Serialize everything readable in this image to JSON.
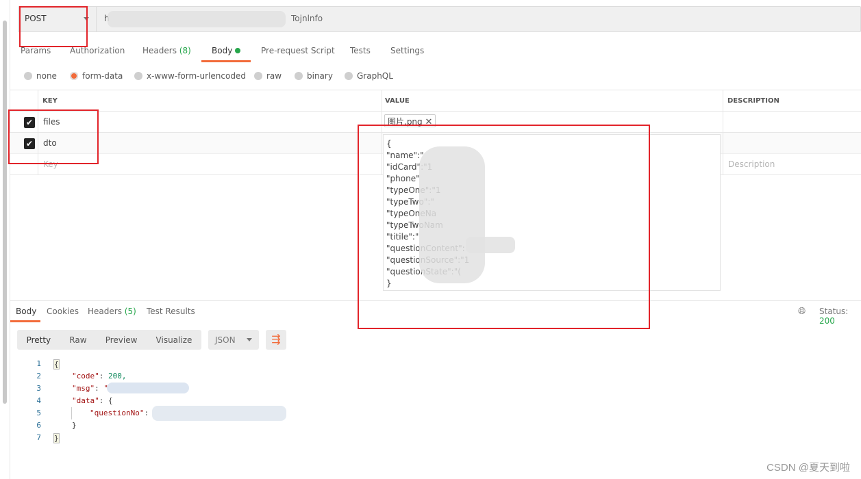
{
  "request": {
    "method": "POST",
    "url_visible_prefix": "h",
    "url_visible_suffix": "Tojnlnfo"
  },
  "tabs": [
    {
      "label": "Params"
    },
    {
      "label": "Authorization"
    },
    {
      "label": "Headers",
      "count": "(8)"
    },
    {
      "label": "Body"
    },
    {
      "label": "Pre-request Script"
    },
    {
      "label": "Tests"
    },
    {
      "label": "Settings"
    }
  ],
  "body_types": [
    {
      "label": "none"
    },
    {
      "label": "form-data",
      "selected": true
    },
    {
      "label": "x-www-form-urlencoded"
    },
    {
      "label": "raw"
    },
    {
      "label": "binary"
    },
    {
      "label": "GraphQL"
    }
  ],
  "table": {
    "headers": [
      "KEY",
      "VALUE",
      "DESCRIPTION"
    ],
    "rows": [
      {
        "key": "files",
        "checked": true,
        "value": "图片.png"
      },
      {
        "key": "dto",
        "checked": true,
        "value": "{\n\"name\":\"\n\"idCard\":\"1\n\"phone\"\n\"typeOne\":\"1\n\"typeTwo\":\"\n\"typeOneNa\n\"typeTwoNam\n\"titile\":\"\n\"questionContent\":\n\"questionSource\":\"1\n\"questionState\":\"(\n}"
      }
    ],
    "key_placeholder": "Key",
    "description_placeholder": "Description"
  },
  "response": {
    "tabs": [
      {
        "label": "Body"
      },
      {
        "label": "Cookies"
      },
      {
        "label": "Headers",
        "count": "(5)"
      },
      {
        "label": "Test Results"
      }
    ],
    "status_label": "Status:",
    "status_code": "200",
    "views": [
      "Pretty",
      "Raw",
      "Preview",
      "Visualize"
    ],
    "format": "JSON",
    "lines": [
      {
        "n": "1",
        "text": "{"
      },
      {
        "n": "2",
        "key": "\"code\"",
        "val": "200,"
      },
      {
        "n": "3",
        "key": "\"msg\"",
        "val": "\""
      },
      {
        "n": "4",
        "key": "\"data\"",
        "val": "{"
      },
      {
        "n": "5",
        "key": "\"questionNo\"",
        "val": ""
      },
      {
        "n": "6",
        "text": "}"
      },
      {
        "n": "7",
        "text": "}"
      }
    ]
  },
  "watermark": "CSDN @夏天到啦",
  "colors": {
    "accent": "#f26b3a",
    "success": "#26a64b",
    "annotation": "#e2242a"
  }
}
